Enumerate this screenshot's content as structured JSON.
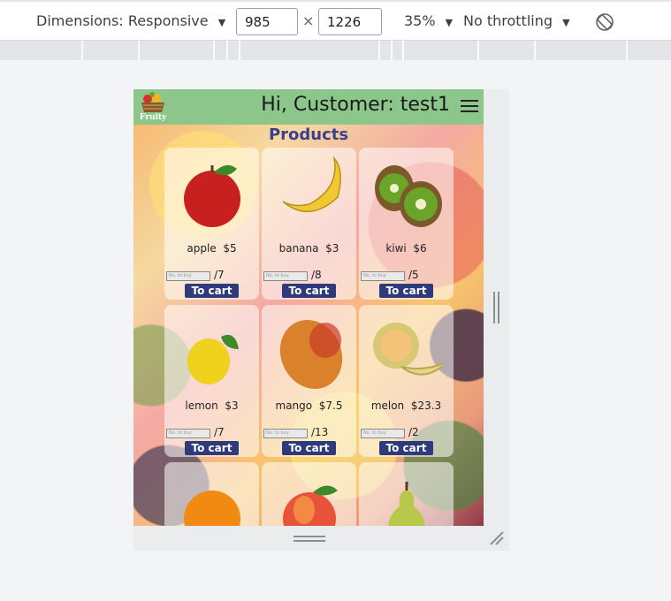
{
  "toolbar": {
    "dimensions_label": "Dimensions: Responsive",
    "width_value": "985",
    "times_symbol": "×",
    "height_value": "1226",
    "zoom_label": "35%",
    "throttling_label": "No throttling",
    "caret": "▼"
  },
  "app": {
    "logo_text": "Fruity",
    "greeting": "Hi, Customer: test1",
    "products_title": "Products",
    "qty_placeholder": "No. to buy",
    "cart_label": "To cart"
  },
  "products": [
    {
      "name": "apple",
      "price": "$5",
      "stock": "/7",
      "color": "#c8201e"
    },
    {
      "name": "banana",
      "price": "$3",
      "stock": "/8",
      "color": "#f2c832"
    },
    {
      "name": "kiwi",
      "price": "$6",
      "stock": "/5",
      "color": "#6aa52a"
    },
    {
      "name": "lemon",
      "price": "$3",
      "stock": "/7",
      "color": "#f0d21e"
    },
    {
      "name": "mango",
      "price": "$7.5",
      "stock": "/13",
      "color": "#d9822b"
    },
    {
      "name": "melon",
      "price": "$23.3",
      "stock": "/2",
      "color": "#d7c873"
    },
    {
      "name": "orange",
      "price": "",
      "stock": "",
      "color": "#f08a12"
    },
    {
      "name": "peach",
      "price": "",
      "stock": "",
      "color": "#e8543a"
    },
    {
      "name": "pear",
      "price": "",
      "stock": "",
      "color": "#b9c84a"
    }
  ]
}
